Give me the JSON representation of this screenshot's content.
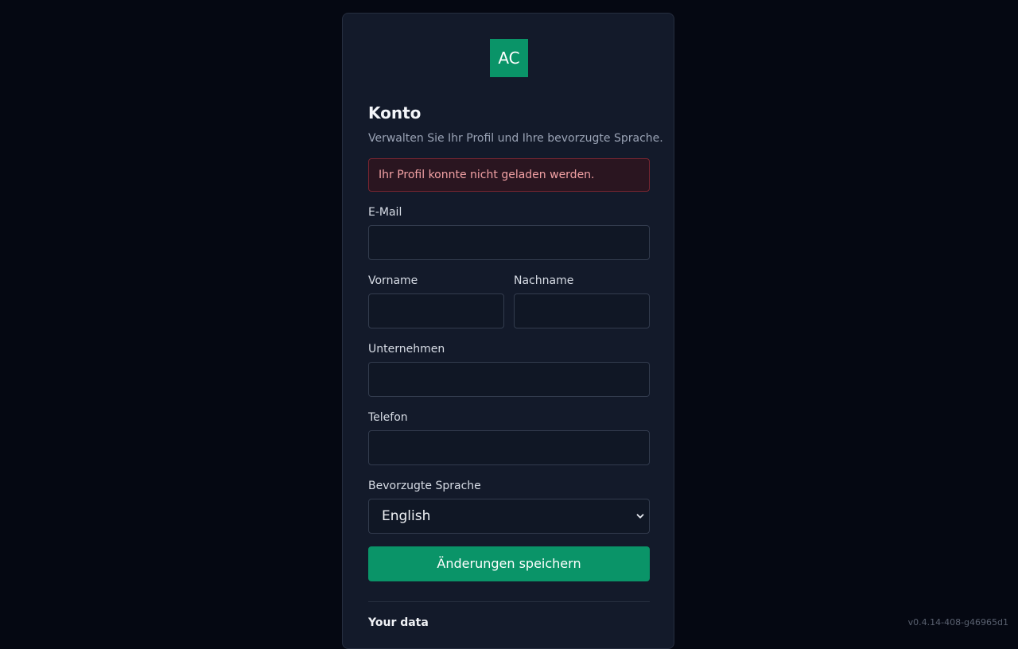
{
  "logo": {
    "initials": "AC"
  },
  "header": {
    "title": "Konto",
    "subtitle": "Verwalten Sie Ihr Profil und Ihre bevorzugte Sprache."
  },
  "alert": {
    "message": "Ihr Profil konnte nicht geladen werden."
  },
  "form": {
    "email": {
      "label": "E-Mail",
      "value": ""
    },
    "first_name": {
      "label": "Vorname",
      "value": ""
    },
    "last_name": {
      "label": "Nachname",
      "value": ""
    },
    "company": {
      "label": "Unternehmen",
      "value": ""
    },
    "phone": {
      "label": "Telefon",
      "value": ""
    },
    "language": {
      "label": "Bevorzugte Sprache",
      "selected": "English"
    },
    "save_label": "Änderungen speichern"
  },
  "your_data": {
    "heading": "Your data"
  },
  "footer": {
    "version": "v0.4.14-408-g46965d1"
  },
  "colors": {
    "accent": "#0a9468",
    "error_text": "#f2a1a4",
    "error_bg": "#2a1520",
    "background": "#050812",
    "card": "#131a2a"
  }
}
